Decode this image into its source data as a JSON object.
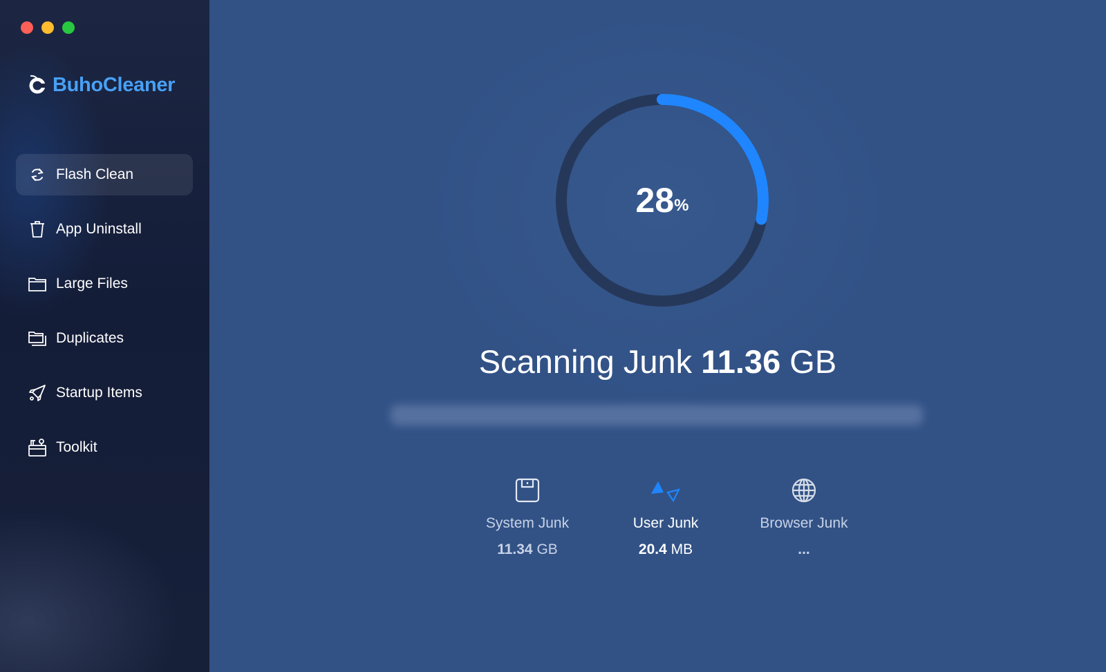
{
  "window": {
    "controls": [
      "close",
      "minimize",
      "zoom"
    ]
  },
  "brand": {
    "name": "BuhoCleaner",
    "icon": "buho-owl-icon",
    "color": "#48a0f5"
  },
  "sidebar": {
    "items": [
      {
        "label": "Flash Clean",
        "icon": "refresh-icon",
        "active": true
      },
      {
        "label": "App Uninstall",
        "icon": "trash-icon",
        "active": false
      },
      {
        "label": "Large Files",
        "icon": "folder-icon",
        "active": false
      },
      {
        "label": "Duplicates",
        "icon": "duplicate-folder-icon",
        "active": false
      },
      {
        "label": "Startup Items",
        "icon": "rocket-icon",
        "active": false
      },
      {
        "label": "Toolkit",
        "icon": "toolbox-icon",
        "active": false
      }
    ]
  },
  "scan": {
    "progress_percent": 28,
    "progress_number": "28",
    "progress_symbol": "%",
    "progress_color": "#1f86ff",
    "title_prefix": "Scanning Junk",
    "total_value": "11.36",
    "total_unit": "GB",
    "current_path": ""
  },
  "categories": [
    {
      "label": "System Junk",
      "value": "11.34",
      "unit": "GB",
      "icon": "floppy-disk-icon",
      "active": false
    },
    {
      "label": "User Junk",
      "value": "20.4",
      "unit": "MB",
      "icon": "scanning-triangles-icon",
      "active": true
    },
    {
      "label": "Browser Junk",
      "value": "...",
      "unit": "",
      "icon": "globe-icon",
      "active": false
    }
  ]
}
